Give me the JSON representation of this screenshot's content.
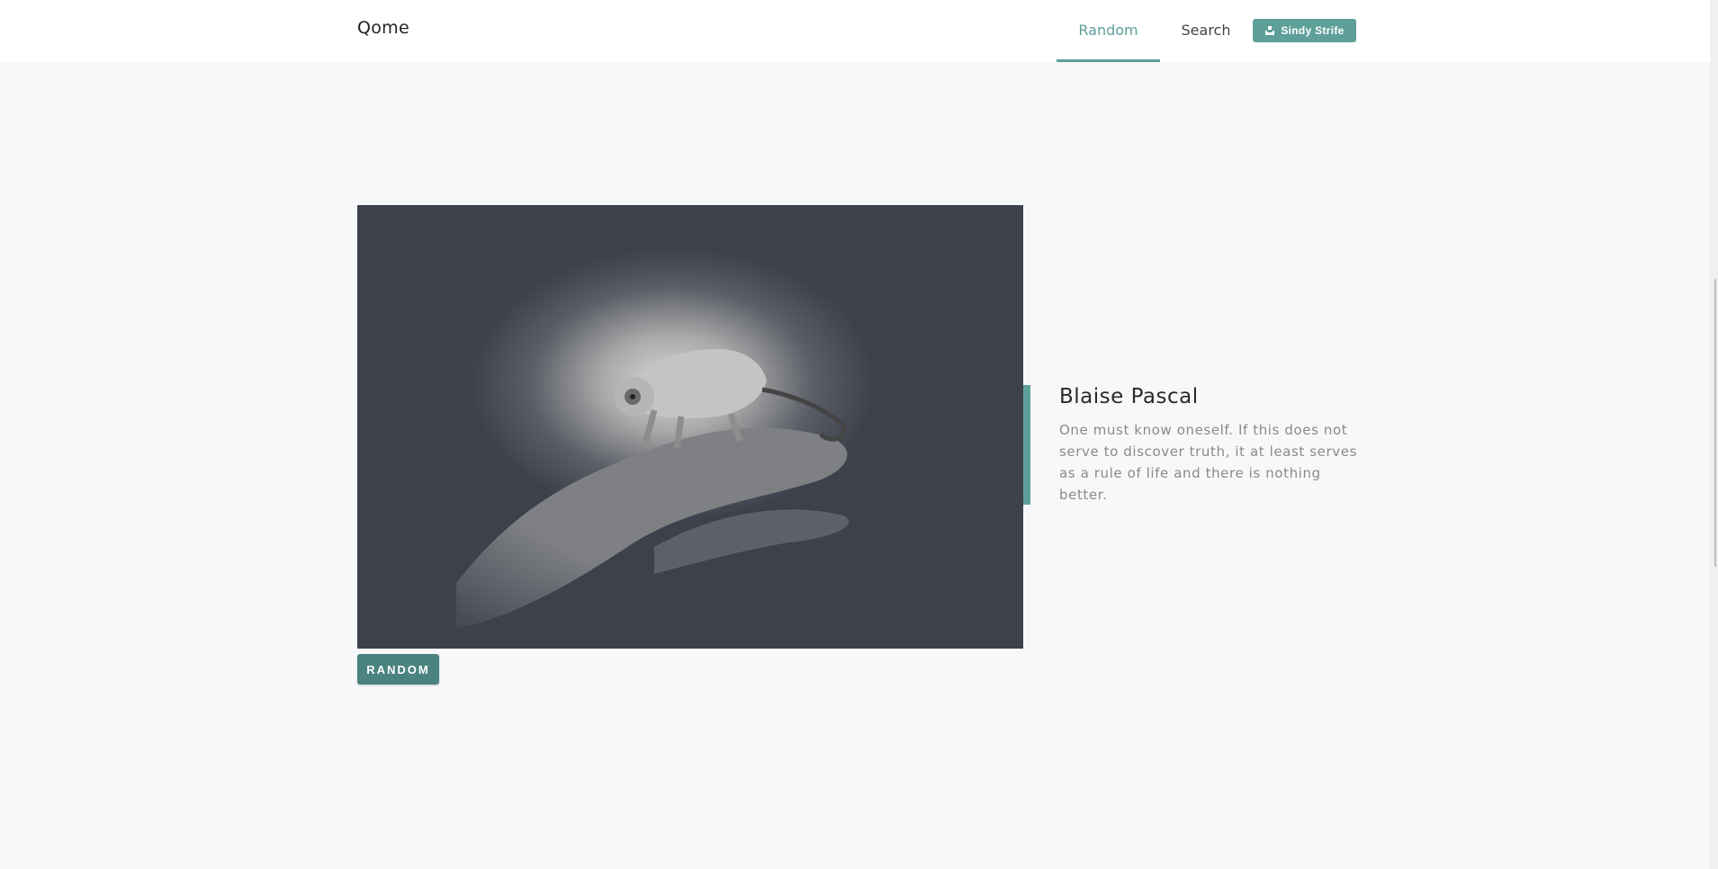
{
  "nav": {
    "brand": "Qome",
    "links": [
      {
        "label": "Random",
        "active": true
      },
      {
        "label": "Search",
        "active": false
      }
    ],
    "user_button": {
      "label": "Sindy Strife",
      "icon": "user-icon"
    }
  },
  "main": {
    "image": {
      "icon": "photo-chameleon"
    },
    "random_button": "RANDOM",
    "quote": {
      "author": "Blaise Pascal",
      "text": "One must know oneself. If this does not serve to discover truth, it at least serves as a rule of life and there is nothing better."
    }
  },
  "colors": {
    "accent": "#5f9f9a",
    "button_dark": "#4a8380",
    "background": "#f7f8f9",
    "photo_bg": "#3c414b"
  }
}
